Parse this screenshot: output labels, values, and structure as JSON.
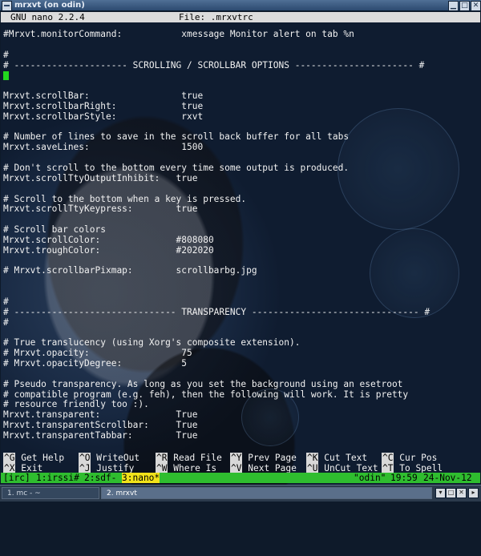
{
  "window": {
    "title": "mrxvt (on odin)"
  },
  "nano": {
    "version": "GNU nano 2.2.4",
    "file": "File: .mrxvtrc"
  },
  "editor_lines": [
    "#Mrxvt.monitorCommand:           xmessage Monitor alert on tab %n",
    "",
    "#",
    "# --------------------- SCROLLING / SCROLLBAR OPTIONS ---------------------- #",
    "",
    "",
    "Mrxvt.scrollBar:                 true",
    "Mrxvt.scrollbarRight:            true",
    "Mrxvt.scrollbarStyle:            rxvt",
    "",
    "# Number of lines to save in the scroll back buffer for all tabs",
    "Mrxvt.saveLines:                 1500",
    "",
    "# Don't scroll to the bottom every time some output is produced.",
    "Mrxvt.scrollTtyOutputInhibit:   true",
    "",
    "# Scroll to the bottom when a key is pressed.",
    "Mrxvt.scrollTtyKeypress:        true",
    "",
    "# Scroll bar colors",
    "Mrxvt.scrollColor:              #808080",
    "Mrxvt.troughColor:              #202020",
    "",
    "# Mrxvt.scrollbarPixmap:        scrollbarbg.jpg",
    "",
    "",
    "#",
    "# ------------------------------ TRANSPARENCY ------------------------------- #",
    "#",
    "",
    "# True translucency (using Xorg's composite extension).",
    "# Mrxvt.opacity:                 75",
    "# Mrxvt.opacityDegree:           5",
    "",
    "# Pseudo transparency. As long as you set the background using an esetroot",
    "# compatible program (e.g. feh), then the following will work. It is pretty",
    "# resource friendly too :).",
    "Mrxvt.transparent:              True",
    "Mrxvt.transparentScrollbar:     True",
    "Mrxvt.transparentTabbar:        True"
  ],
  "shortcuts_row1": [
    {
      "key": "^G",
      "label": "Get Help"
    },
    {
      "key": "^O",
      "label": "WriteOut"
    },
    {
      "key": "^R",
      "label": "Read File"
    },
    {
      "key": "^Y",
      "label": "Prev Page"
    },
    {
      "key": "^K",
      "label": "Cut Text"
    },
    {
      "key": "^C",
      "label": "Cur Pos"
    }
  ],
  "shortcuts_row2": [
    {
      "key": "^X",
      "label": "Exit"
    },
    {
      "key": "^J",
      "label": "Justify"
    },
    {
      "key": "^W",
      "label": "Where Is"
    },
    {
      "key": "^V",
      "label": "Next Page"
    },
    {
      "key": "^U",
      "label": "UnCut Text"
    },
    {
      "key": "^T",
      "label": "To Spell"
    }
  ],
  "screen": {
    "group": "[irc]",
    "windows": [
      "1:irssi#",
      "2:sdf-",
      "3:nano*"
    ],
    "active_window": 2,
    "host": "\"odin\"",
    "time": "19:59",
    "date": "24-Nov-12"
  },
  "taskbar": {
    "tasks": [
      "1. mc - ~",
      "2. mrxvt"
    ],
    "active_task": 1,
    "buttons": [
      "▾",
      "□",
      "✕",
      "▸"
    ]
  },
  "colors": {
    "cursor": "#22d81e",
    "screenbar": "#2fbd2f",
    "active_window": "#f1e21a"
  }
}
